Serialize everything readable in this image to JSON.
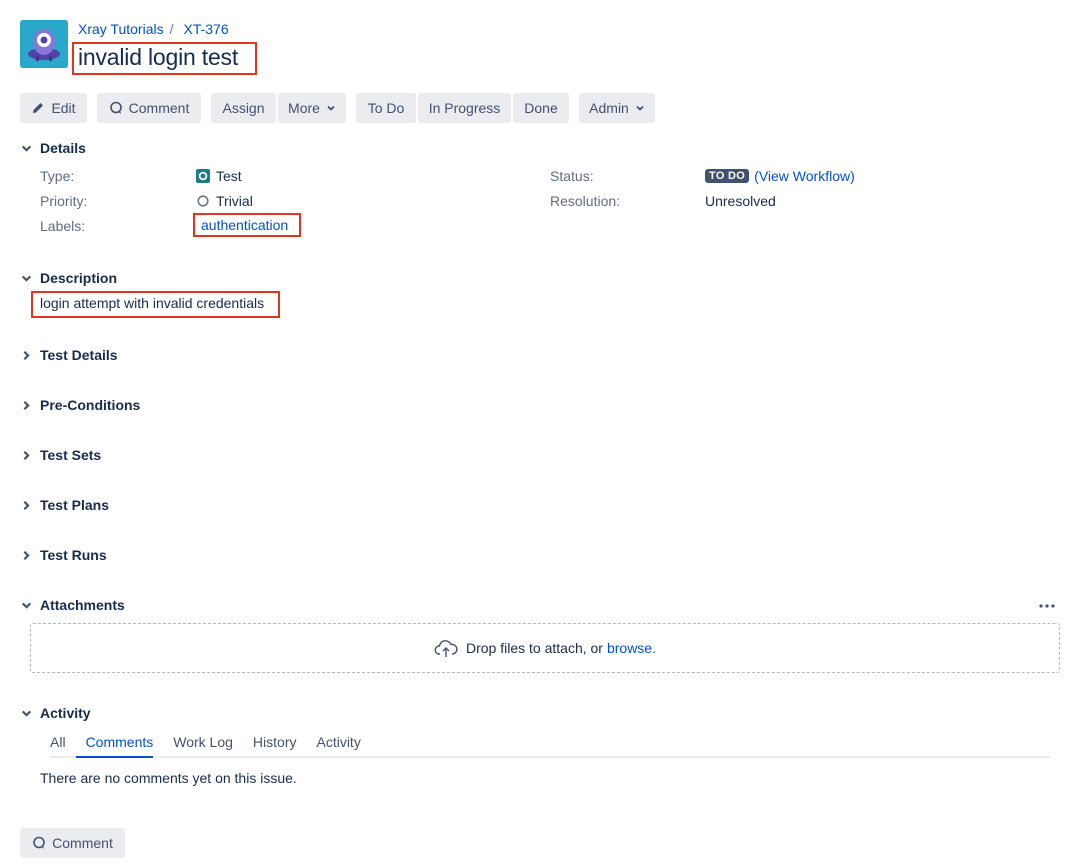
{
  "breadcrumb": {
    "project": "Xray Tutorials",
    "separator": "/",
    "issue_key": "XT-376"
  },
  "issue": {
    "title": "invalid login test"
  },
  "toolbar": {
    "edit": "Edit",
    "comment": "Comment",
    "assign": "Assign",
    "more": "More",
    "todo": "To Do",
    "in_progress": "In Progress",
    "done": "Done",
    "admin": "Admin"
  },
  "details": {
    "heading": "Details",
    "type_label": "Type:",
    "type_value": "Test",
    "priority_label": "Priority:",
    "priority_value": "Trivial",
    "labels_label": "Labels:",
    "labels_value": "authentication",
    "status_label": "Status:",
    "status_value": "TO DO",
    "view_workflow_open": "(",
    "view_workflow": "View Workflow",
    "view_workflow_close": ")",
    "resolution_label": "Resolution:",
    "resolution_value": "Unresolved"
  },
  "description": {
    "heading": "Description",
    "text": "login attempt with invalid credentials"
  },
  "sections": {
    "test_details": "Test Details",
    "pre_conditions": "Pre-Conditions",
    "test_sets": "Test Sets",
    "test_plans": "Test Plans",
    "test_runs": "Test Runs"
  },
  "attachments": {
    "heading": "Attachments",
    "drop_text": "Drop files to attach, or",
    "browse": "browse."
  },
  "activity": {
    "heading": "Activity",
    "tabs": [
      "All",
      "Comments",
      "Work Log",
      "History",
      "Activity"
    ],
    "active_tab": "Comments",
    "empty_text": "There are no comments yet on this issue.",
    "comment_button": "Comment"
  },
  "colors": {
    "link": "#0052cc",
    "highlight": "#e0361f",
    "lozenge": "#42526e",
    "avatar": "#2aa8c9",
    "test_icon": "#1e7a8c"
  }
}
